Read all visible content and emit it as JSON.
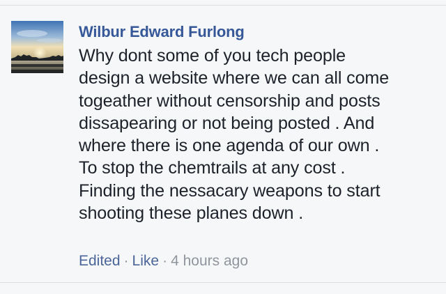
{
  "comment": {
    "author": "Wilbur Edward Furlong",
    "text": "Why dont some of you tech people\ndesign a website where we can all come\ntogeather without censorship and posts\ndissapearing or not being posted . And\nwhere there is one agenda of our own .\nTo stop the chemtrails at any cost .\nFinding the nessacary weapons to start\nshooting these planes down .",
    "edited_label": "Edited",
    "separator": "·",
    "like_label": "Like",
    "timestamp": "4 hours ago",
    "avatar": "sunset-landscape-photo"
  },
  "colors": {
    "background": "#f6f7f9",
    "author": "#365899",
    "text": "#1d2129",
    "action_link": "#4b6599",
    "muted": "#90949c"
  }
}
